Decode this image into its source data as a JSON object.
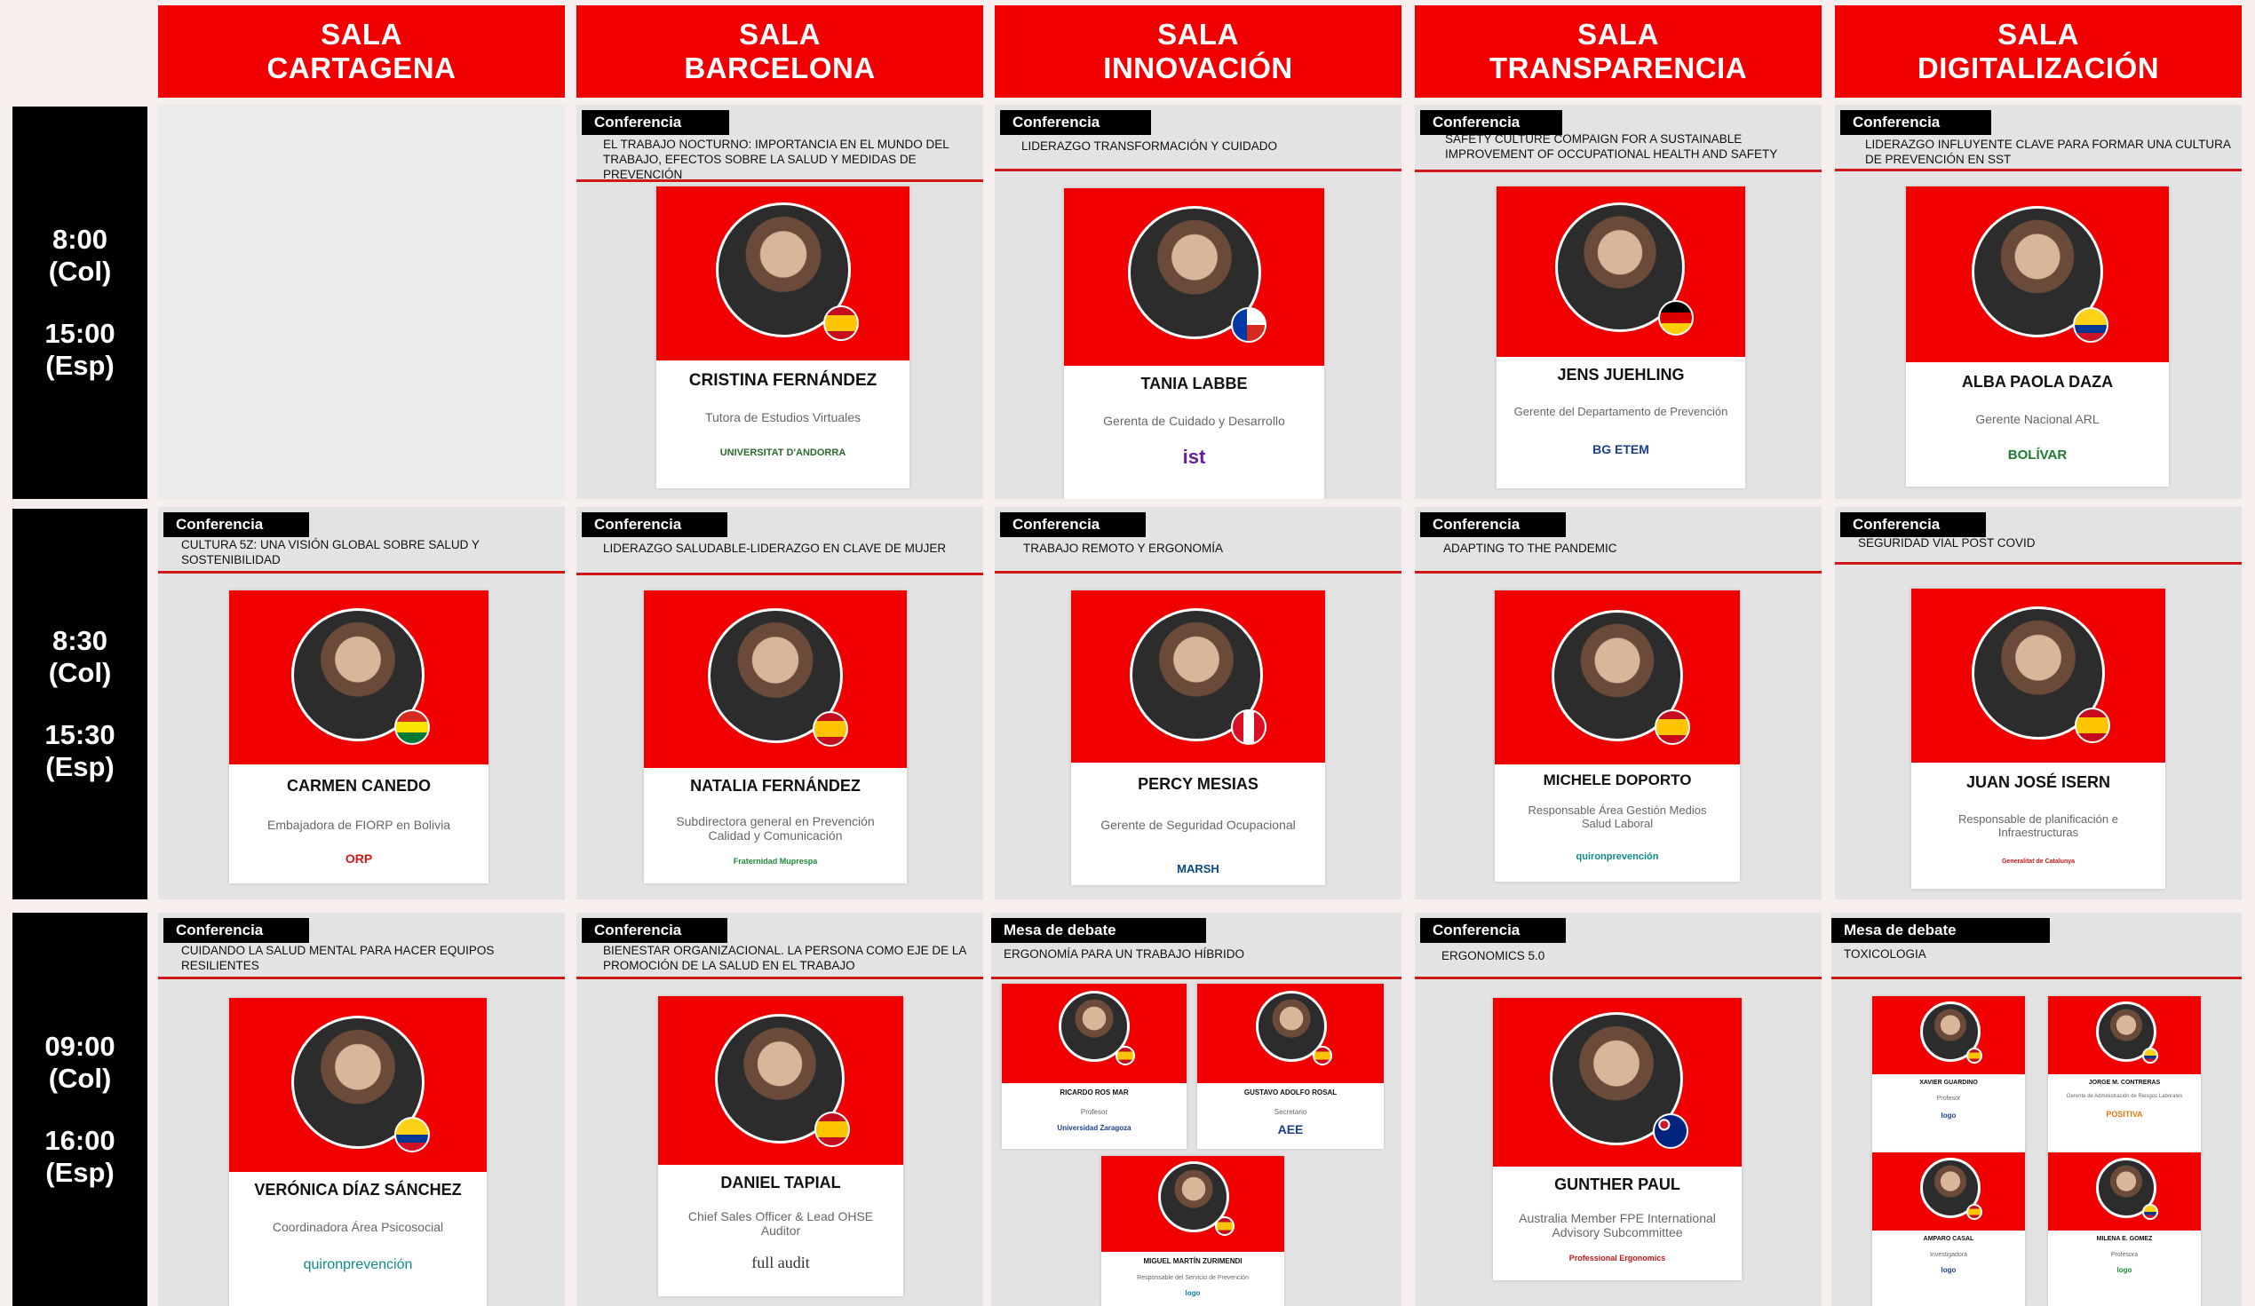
{
  "halls": [
    {
      "line1": "SALA",
      "line2": "CARTAGENA"
    },
    {
      "line1": "SALA",
      "line2": "BARCELONA"
    },
    {
      "line1": "SALA",
      "line2": "INNOVACIÓN"
    },
    {
      "line1": "SALA",
      "line2": "TRANSPARENCIA"
    },
    {
      "line1": "SALA",
      "line2": "DIGITALIZACIÓN"
    }
  ],
  "times": [
    {
      "col": "8:00",
      "col_tz": "(Col)",
      "esp": "15:00",
      "esp_tz": "(Esp)"
    },
    {
      "col": "8:30",
      "col_tz": "(Col)",
      "esp": "15:30",
      "esp_tz": "(Esp)"
    },
    {
      "col": "09:00",
      "col_tz": "(Col)",
      "esp": "16:00",
      "esp_tz": "(Esp)"
    }
  ],
  "sessions": {
    "r1c2": {
      "tag": "Conferencia",
      "topic": "EL TRABAJO NOCTURNO: IMPORTANCIA EN EL MUNDO DEL TRABAJO, EFECTOS SOBRE LA SALUD Y MEDIDAS DE PREVENCIÓN",
      "name": "CRISTINA FERNÁNDEZ",
      "role": "Tutora de Estudios Virtuales",
      "logo": "UNIVERSITAT D'ANDORRA",
      "flag": "es"
    },
    "r1c3": {
      "tag": "Conferencia",
      "topic": "LIDERAZGO TRANSFORMACIÓN Y CUIDADO",
      "name": "TANIA LABBE",
      "role": "Gerenta de Cuidado y Desarrollo",
      "logo": "ist",
      "flag": "cl"
    },
    "r1c4": {
      "tag": "Conferencia",
      "topic": "SAFETY CULTURE COMPAIGN FOR A SUSTAINABLE IMPROVEMENT OF OCCUPATIONAL HEALTH AND SAFETY",
      "name": "JENS JUEHLING",
      "role": "Gerente del Departamento de Prevención",
      "logo": "BG ETEM",
      "flag": "de"
    },
    "r1c5": {
      "tag": "Conferencia",
      "topic": "LIDERAZGO INFLUYENTE CLAVE PARA FORMAR UNA CULTURA DE PREVENCIÓN EN SST",
      "name": "ALBA PAOLA DAZA",
      "role": "Gerente Nacional ARL",
      "logo": "BOLÍVAR",
      "flag": "co"
    },
    "r2c1": {
      "tag": "Conferencia",
      "topic": "CULTURA 5Z: UNA VISIÓN GLOBAL SOBRE SALUD Y SOSTENIBILIDAD",
      "name": "CARMEN CANEDO",
      "role": "Embajadora de FIORP en Bolivia",
      "logo": "ORP",
      "flag": "bo"
    },
    "r2c2": {
      "tag": "Conferencia",
      "topic": "LIDERAZGO SALUDABLE-LIDERAZGO EN CLAVE DE MUJER",
      "name": "NATALIA FERNÁNDEZ",
      "role": "Subdirectora general en Prevención Calidad y Comunicación",
      "logo": "Fraternidad Muprespa",
      "flag": "es"
    },
    "r2c3": {
      "tag": "Conferencia",
      "topic": "TRABAJO REMOTO Y ERGONOMÍA",
      "name": "PERCY MESIAS",
      "role": "Gerente de Seguridad Ocupacional",
      "logo": "MARSH",
      "flag": "pe"
    },
    "r2c4": {
      "tag": "Conferencia",
      "topic": "ADAPTING TO THE PANDEMIC",
      "name": "MICHELE DOPORTO",
      "role": "Responsable Área Gestión Medios Salud Laboral",
      "logo": "quironprevención",
      "flag": "es"
    },
    "r2c5": {
      "tag": "Conferencia",
      "topic": "SEGURIDAD VIAL POST COVID",
      "name": "JUAN JOSÉ ISERN",
      "role": "Responsable de planificación e Infraestructuras",
      "logo": "Generalitat de Catalunya",
      "flag": "es"
    },
    "r3c1": {
      "tag": "Conferencia",
      "topic": "CUIDANDO LA SALUD MENTAL PARA HACER EQUIPOS RESILIENTES",
      "name": "VERÓNICA DÍAZ SÁNCHEZ",
      "role": "Coordinadora Área Psicosocial",
      "logo": "quironprevención",
      "flag": "co"
    },
    "r3c2": {
      "tag": "Conferencia",
      "topic": "BIENESTAR ORGANIZACIONAL. LA PERSONA COMO EJE DE LA PROMOCIÓN DE LA SALUD EN EL TRABAJO",
      "name": "DANIEL TAPIAL",
      "role": "Chief Sales Officer & Lead OHSE Auditor",
      "logo": "full audit",
      "flag": "es"
    },
    "r3c3": {
      "tag": "Mesa de debate",
      "topic": "ERGONOMÍA PARA UN TRABAJO HÍBRIDO",
      "panel": [
        {
          "name": "RICARDO ROS MAR",
          "role": "Profesor",
          "logo": "Universidad Zaragoza"
        },
        {
          "name": "GUSTAVO ADOLFO ROSAL",
          "role": "Secretario",
          "logo": "AEE"
        },
        {
          "name": "MIGUEL MARTÍN ZURIMENDI",
          "role": "Responsable del Servicio de Prevención",
          "logo": "logo"
        }
      ]
    },
    "r3c4": {
      "tag": "Conferencia",
      "topic": "ERGONOMICS 5.0",
      "name": "GUNTHER PAUL",
      "role": "Australia Member FPE International Advisory Subcommittee",
      "logo": "Professional Ergonomics",
      "flag": "au"
    },
    "r3c5": {
      "tag": "Mesa de debate",
      "topic": "TOXICOLOGIA",
      "panel": [
        {
          "name": "XAVIER GUARDINO",
          "role": "Profesor",
          "logo": "logo"
        },
        {
          "name": "JORGE M. CONTRERAS",
          "role": "Gerente de Administración de Riesgos Laborales",
          "logo": "POSITIVA"
        },
        {
          "name": "AMPARO CASAL",
          "role": "Investigadora",
          "logo": "logo"
        },
        {
          "name": "MILENA E. GOMEZ",
          "role": "Profesora",
          "logo": "logo"
        }
      ]
    }
  },
  "colors": {
    "red": "#f00000",
    "dark": "#000000",
    "cell": "#e3e3e3"
  }
}
